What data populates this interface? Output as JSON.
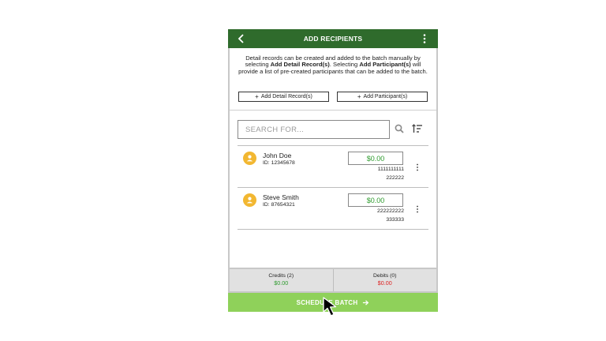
{
  "header": {
    "title": "ADD RECIPIENTS"
  },
  "description": {
    "part1": "Detail records can be created and added to the batch manually by selecting ",
    "bold1": "Add Detail Record(s)",
    "part2": ". Selecting ",
    "bold2": "Add Participant(s)",
    "part3": " will provide a list of pre-created participants that can be added to the batch."
  },
  "actions": {
    "add_detail_label": "Add Detail Record(s)",
    "add_participant_label": "Add Participant(s)"
  },
  "search": {
    "placeholder": "SEARCH FOR..."
  },
  "recipients": [
    {
      "name": "John Doe",
      "id": "ID: 12345678",
      "amount": "$0.00",
      "account": "1111111111",
      "routing": "222222"
    },
    {
      "name": "Steve Smith",
      "id": "ID: 87654321",
      "amount": "$0.00",
      "account": "222222222",
      "routing": "333333"
    }
  ],
  "footer": {
    "credits_label": "Credits (2)",
    "credits_value": "$0.00",
    "debits_label": "Debits (0)",
    "debits_value": "$0.00"
  },
  "schedule": {
    "label": "SCHEDULE BATCH"
  },
  "colors": {
    "header": "#2f6b2c",
    "schedule": "#8fd15a",
    "credit": "#2e9b2e",
    "debit": "#dd2222",
    "avatar": "#f2b731"
  },
  "icons": [
    "back-arrow-icon",
    "more-vert-icon",
    "search-icon",
    "sort-icon",
    "person-icon",
    "kebab-icon",
    "arrow-right-icon",
    "mouse-pointer-icon"
  ]
}
